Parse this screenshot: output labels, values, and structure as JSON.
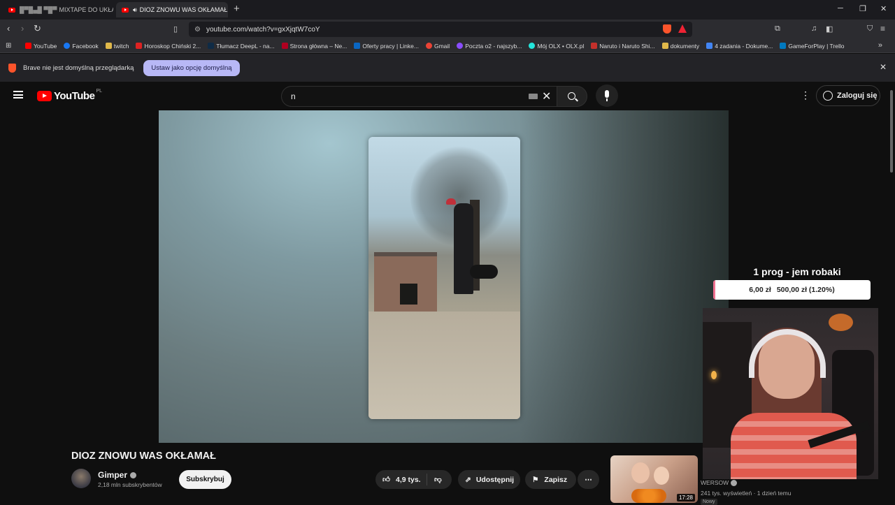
{
  "browser": {
    "tabs": [
      {
        "label": "MIXTAPE DO UKŁAD",
        "prefix": "█▀█▄█ ▀█▀"
      },
      {
        "label": "DIOZ ZNOWU WAS OKŁAMAŁ",
        "active": true
      }
    ],
    "new_tab": "+",
    "url": "youtube.com/watch?v=gxXjqtW7coY",
    "window_controls": {
      "minimize": "─",
      "restore": "❐",
      "close": "✕"
    },
    "bookmarks": [
      {
        "label": "YouTube",
        "color": "#ff0000"
      },
      {
        "label": "Facebook",
        "color": "#1877f2"
      },
      {
        "label": "twitch",
        "color": "#e0b84a"
      },
      {
        "label": "Horoskop Chiński 2...",
        "color": "#d22"
      },
      {
        "label": "Tłumacz DeepL - na...",
        "color": "#0f2b46"
      },
      {
        "label": "Strona główna – Ne...",
        "color": "#b00020"
      },
      {
        "label": "Oferty pracy | Linke...",
        "color": "#0a66c2"
      },
      {
        "label": "Gmail",
        "color": "#ea4335"
      },
      {
        "label": "Poczta o2 - najszyb...",
        "color": "#8a4dff"
      },
      {
        "label": "Mój OLX • OLX.pl",
        "color": "#23e5db"
      },
      {
        "label": "Naruto i Naruto Shi...",
        "color": "#c4302b"
      },
      {
        "label": "dokumenty",
        "color": "#e0b84a"
      },
      {
        "label": "4 zadania - Dokume...",
        "color": "#4285f4"
      },
      {
        "label": "GameForPlay | Trello",
        "color": "#0079bf"
      }
    ],
    "notification": {
      "text": "Brave nie jest domyślną przeglądarką",
      "button": "Ustaw jako opcję domyślną"
    }
  },
  "youtube": {
    "logo": "YouTube",
    "country": "PL",
    "search_value": "n",
    "sign_in": "Zaloguj się",
    "video": {
      "title": "DIOZ ZNOWU WAS OKŁAMAŁ",
      "channel": "Gimper",
      "subscribers": "2,18 mln subskrybentów",
      "subscribe": "Subskrybuj",
      "likes": "4,9 tys.",
      "share": "Udostępnij",
      "save": "Zapisz",
      "more": "⋯"
    },
    "suggestion": {
      "duration": "17:28",
      "channel": "WERSOW",
      "meta": "241 tys. wyświetleń · 1 dzień temu",
      "badge": "Nowy"
    }
  },
  "stream_overlay": {
    "goal_title": "1 prog - jem robaki",
    "goal_current": "6,00 zł",
    "goal_target": "500,00 zł (1.20%)",
    "goal_progress": 0.012
  }
}
